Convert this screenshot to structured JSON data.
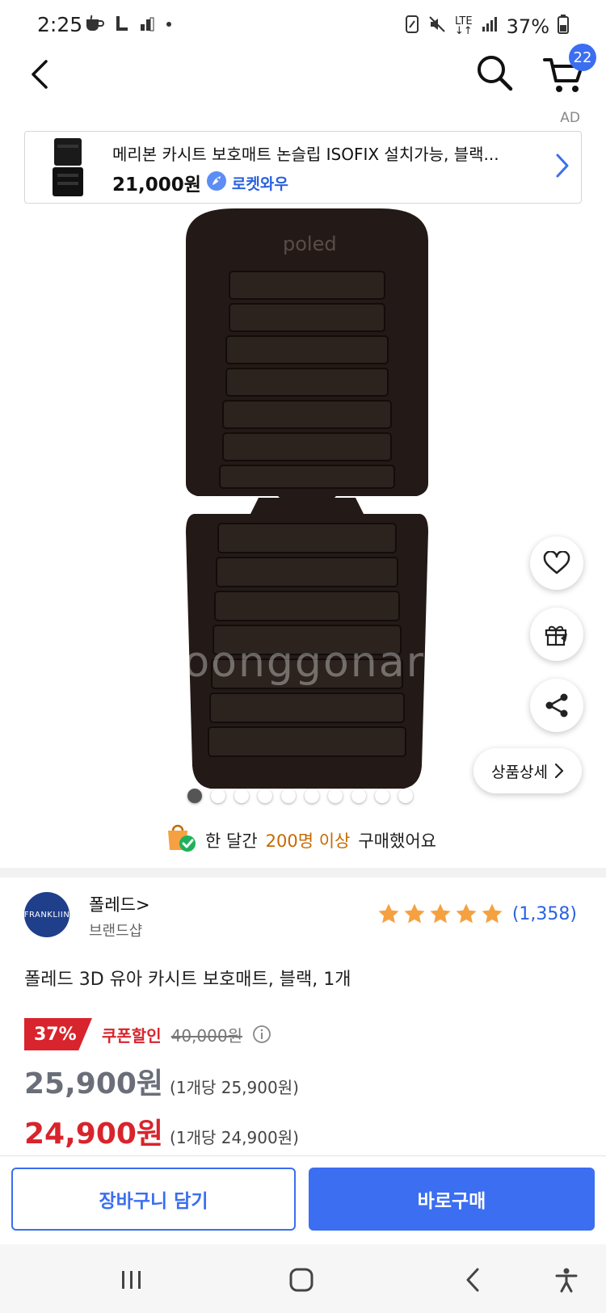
{
  "status_bar": {
    "time": "2:25",
    "network": "LTE",
    "battery": "37%",
    "icons": [
      "coffee-icon",
      "l-icon",
      "graph-icon",
      "dot-icon",
      "nfc-icon",
      "mute-icon",
      "lte-icon",
      "signal-icon",
      "battery-icon"
    ]
  },
  "nav": {
    "cart_count": "22",
    "ad_label": "AD"
  },
  "ad_banner": {
    "title": "메리본 카시트 보호매트 논슬립 ISOFIX 설치가능, 블랙...",
    "price": "21,000원",
    "rocket_label": "로켓와우"
  },
  "product_image": {
    "brand_text": "poled",
    "watermark": "Joonggonara"
  },
  "floating": {
    "detail_label": "상품상세"
  },
  "carousel": {
    "count": 10,
    "active_index": 0
  },
  "purchase_info": {
    "prefix": "한 달간",
    "highlight": "200명 이상",
    "suffix": "구매했어요"
  },
  "brand": {
    "logo_text": "FRANKLIIN",
    "name": "폴레드>",
    "shop_label": "브랜드샵",
    "rating_stars": 5,
    "review_count": "(1,358)"
  },
  "product": {
    "title": "폴레드 3D 유아 카시트 보호매트, 블랙, 1개"
  },
  "pricing": {
    "discount_rate": "37%",
    "coupon_label": "쿠폰할인",
    "original_price": "40,000원",
    "price": "25,900원",
    "price_unit": "(1개당 25,900원)",
    "coupon_price": "24,900원",
    "coupon_unit": "(1개당 24,900원)"
  },
  "actions": {
    "add_to_cart": "장바구니 담기",
    "buy_now": "바로구매"
  },
  "colors": {
    "accent_blue": "#3b6ef0",
    "sale_red": "#d8242c",
    "star_orange": "#f5a142"
  }
}
